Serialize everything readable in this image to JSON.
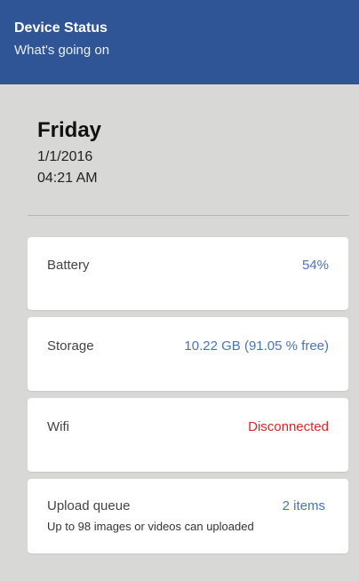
{
  "header": {
    "title": "Device Status",
    "subtitle": "What's going on"
  },
  "datetime": {
    "day": "Friday",
    "date": "1/1/2016",
    "time": "04:21 AM"
  },
  "status_cards": [
    {
      "label": "Battery",
      "value": "54%",
      "value_color": "#4a74b8"
    },
    {
      "label": "Storage",
      "value": "10.22 GB (91.05 % free)",
      "value_color": "#4a74b8"
    },
    {
      "label": "Wifi",
      "value": "Disconnected",
      "value_color": "#e02424"
    },
    {
      "label": "Upload queue",
      "value": "2 items",
      "value_color": "#4a74b8",
      "note": "Up to 98 images or videos can uploaded"
    }
  ],
  "colors": {
    "header_bg": "#2f5597",
    "page_bg": "#d8d8d6"
  }
}
